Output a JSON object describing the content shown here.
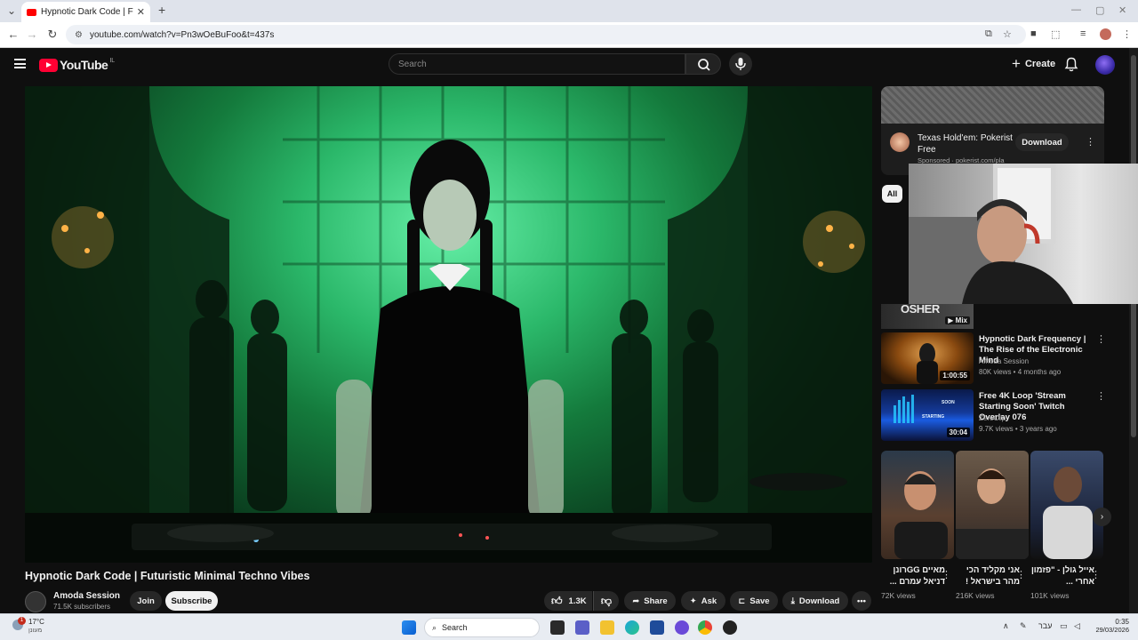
{
  "browser": {
    "tab_title": "Hypnotic Dark Code | Futuristic",
    "new_tab": "+",
    "url": "youtube.com/watch?v=Pn3wOeBuFoo&t=437s"
  },
  "youtube": {
    "logo": "YouTube",
    "region": "IL",
    "search_placeholder": "Search",
    "create_label": "Create"
  },
  "video": {
    "title": "Hypnotic Dark Code | Futuristic Minimal Techno Vibes",
    "channel": "Amoda Session",
    "subscribers": "71.5K subscribers",
    "join": "Join",
    "subscribe": "Subscribe",
    "likes": "1.3K",
    "share": "Share",
    "ask": "Ask",
    "save": "Save",
    "download": "Download"
  },
  "sidebar": {
    "ad": {
      "title": "Texas Hold'em: Pokerist Free",
      "sponsored": "Sponsored · pokerist.com/pla",
      "button": "Download"
    },
    "chip_all": "All",
    "mix_label": "Mix",
    "mix_thumb_text": "OSHER",
    "recommendations": [
      {
        "title": "Hypnotic Dark Frequency | The Rise of the Electronic Mind",
        "channel": "Amoda Session",
        "meta": "80K views • 4 months ago",
        "duration": "1:00:55"
      },
      {
        "title": "Free 4K Loop 'Stream Starting Soon' Twitch Overlay 076",
        "channel": "ZeroClip",
        "meta": "9.7K views • 3 years ago",
        "duration": "30:04",
        "thumb_text_1": "SOON",
        "thumb_text_2": "STARTING"
      }
    ],
    "shorts": [
      {
        "title": "מאיים GGרונן דניאל עמרם ...",
        "views": "72K views"
      },
      {
        "title": "אני מקליד הכי מהר בישראל !",
        "views": "216K views"
      },
      {
        "title": "אייל גולן - \"פזמון אחרי ...",
        "views": "101K views"
      }
    ]
  },
  "taskbar": {
    "temperature": "17°C",
    "condition": "מעונן",
    "search": "Search",
    "notification_badge": "1",
    "language": "עבר",
    "time": "0:35",
    "date": "29/03/2026"
  },
  "colors": {
    "youtube_red": "#ff0033",
    "page_bg": "#0f0f0f",
    "pill_bg": "#272727"
  }
}
